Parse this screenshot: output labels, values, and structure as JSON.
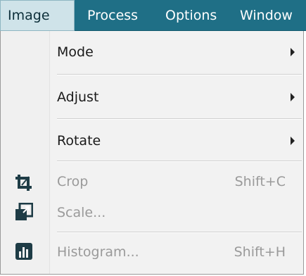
{
  "menubar": {
    "items": [
      {
        "label": "Image",
        "active": true
      },
      {
        "label": "Process"
      },
      {
        "label": "Options"
      },
      {
        "label": "Window"
      }
    ]
  },
  "dropdown": {
    "items": [
      {
        "label": "Mode",
        "submenu": true,
        "enabled": true
      },
      {
        "label": "Adjust",
        "submenu": true,
        "enabled": true
      },
      {
        "label": "Rotate",
        "submenu": true,
        "enabled": true
      },
      {
        "label": "Crop",
        "shortcut": "Shift+C",
        "enabled": false,
        "icon": "crop-icon"
      },
      {
        "label": "Scale...",
        "enabled": false,
        "icon": "scale-icon"
      },
      {
        "label": "Histogram...",
        "shortcut": "Shift+H",
        "enabled": false,
        "icon": "histogram-icon"
      }
    ]
  },
  "colors": {
    "menubar_bg": "#1f6f86",
    "menu_bg": "#f2f2f2",
    "disabled_text": "#9a9a9a",
    "icon_dark": "#1e3c46"
  }
}
